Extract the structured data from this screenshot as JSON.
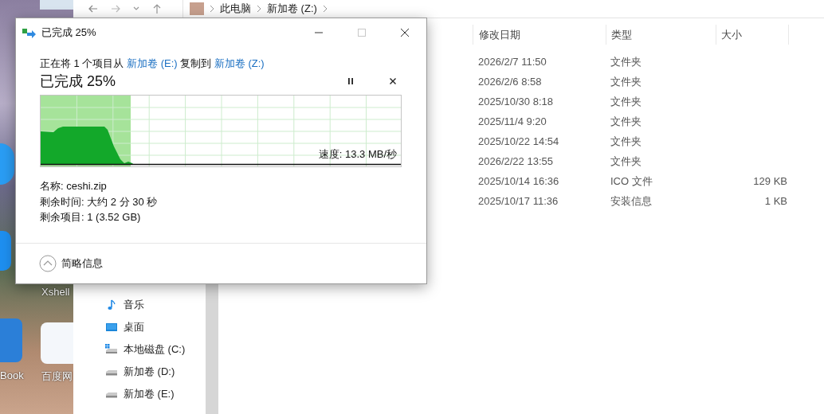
{
  "desktop": {
    "icon_labels": [
      {
        "label": "Xshell"
      },
      {
        "label": "百度网"
      },
      {
        "label": "Book"
      }
    ]
  },
  "explorer": {
    "breadcrumb": [
      "此电脑",
      "新加卷 (Z:)"
    ],
    "nav_items": [
      {
        "label": "音乐",
        "kind": "music"
      },
      {
        "label": "桌面",
        "kind": "desktop"
      },
      {
        "label": "本地磁盘 (C:)",
        "kind": "system-drive"
      },
      {
        "label": "新加卷 (D:)",
        "kind": "drive"
      },
      {
        "label": "新加卷 (E:)",
        "kind": "drive"
      }
    ],
    "columns": [
      "修改日期",
      "类型",
      "大小"
    ],
    "rows": [
      {
        "date": "2026/2/7 11:50",
        "type": "文件夹"
      },
      {
        "date": "2026/2/6 8:58",
        "type": "文件夹"
      },
      {
        "date": "2025/10/30 8:18",
        "type": "文件夹"
      },
      {
        "date": "2025/11/4 9:20",
        "type": "文件夹"
      },
      {
        "date": "2025/10/22 14:54",
        "type": "文件夹"
      },
      {
        "date": "2026/2/22 13:55",
        "type": "文件夹"
      },
      {
        "date": "2025/10/14 16:36",
        "type": "ICO 文件",
        "size": "129 KB"
      },
      {
        "date": "2025/10/17 11:36",
        "type": "安装信息",
        "size": "1 KB"
      }
    ]
  },
  "dialog": {
    "title": "已完成 25%",
    "description": [
      {
        "text": "正在将 1 个项目从 ",
        "kind": "text"
      },
      {
        "text": "新加卷 (E:)",
        "kind": "link"
      },
      {
        "text": " 复制到 ",
        "kind": "text"
      },
      {
        "text": "新加卷 (Z:)",
        "kind": "link"
      }
    ],
    "heading": "已完成 25%",
    "level": 0.25,
    "speed": "速度: 13.3 MB/秒",
    "details": [
      "名称: ceshi.zip",
      "剩余时间: 大约 2 分 30 秒",
      "剩余项目: 1 (3.52 GB)"
    ],
    "footer": "简略信息"
  }
}
